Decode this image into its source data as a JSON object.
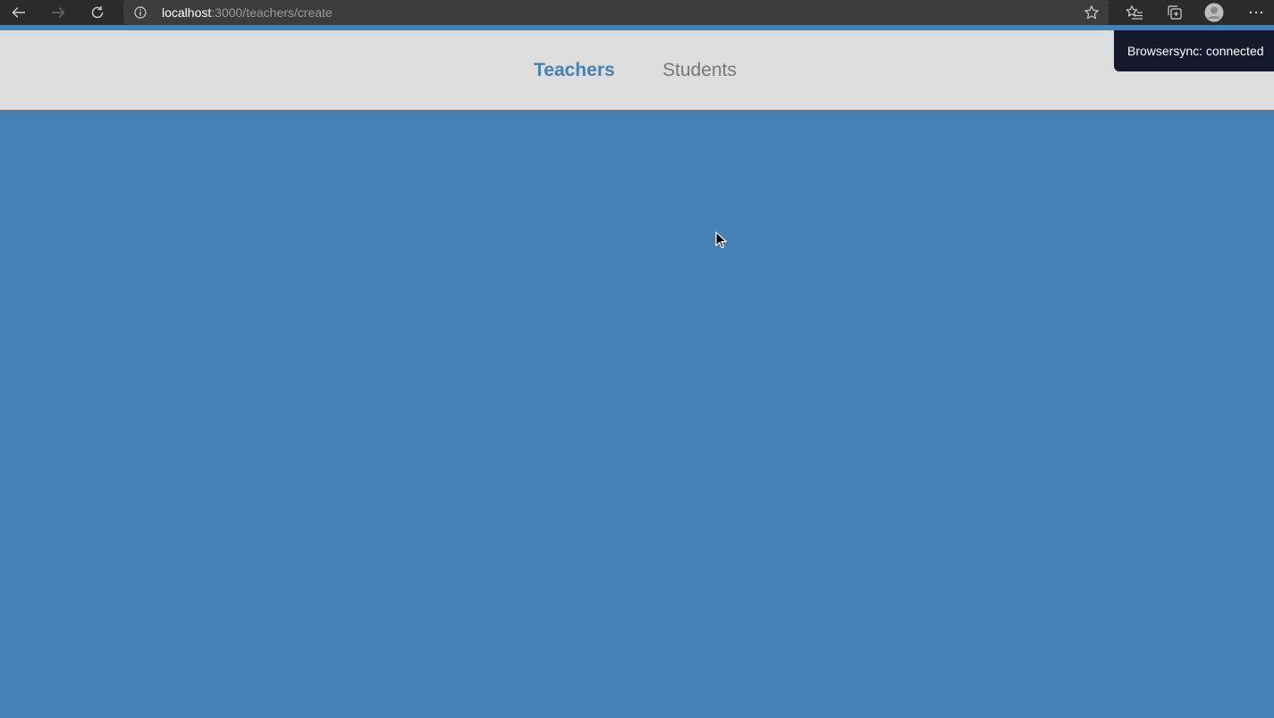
{
  "browser": {
    "url_host": "localhost",
    "url_rest": ":3000/teachers/create",
    "icons": [
      "back-icon",
      "forward-icon",
      "reload-icon",
      "info-icon",
      "star-icon",
      "favorites-icon",
      "collections-icon",
      "profile-icon",
      "more-icon"
    ]
  },
  "nav": {
    "items": [
      {
        "label": "Teachers",
        "active": true
      },
      {
        "label": "Students",
        "active": false
      }
    ]
  },
  "toast": {
    "text": "Browsersync: connected"
  },
  "colors": {
    "accent": "#4581b5",
    "header_bg": "#dddddd",
    "toast_bg": "#141a2c",
    "chrome_bg": "#2b2b2b"
  }
}
